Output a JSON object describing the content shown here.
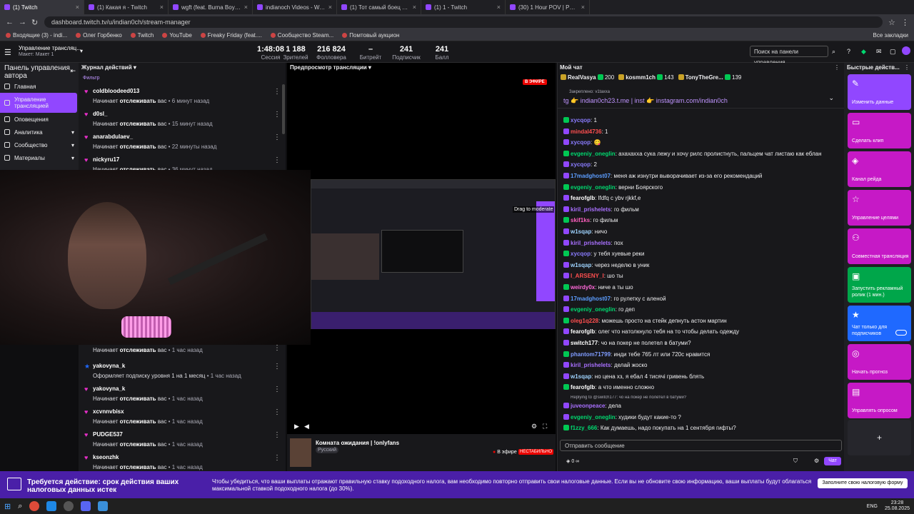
{
  "browser": {
    "tabs": [
      {
        "title": "(1) Twitch",
        "active": true
      },
      {
        "title": "(1) Какая я - Twitch"
      },
      {
        "title": "wgft (feat. Burna Boy) - You"
      },
      {
        "title": "indianoch Videos - Watch On-"
      },
      {
        "title": "(1) Тот самый боец - Twitch"
      },
      {
        "title": "(1) 1 - Twitch"
      },
      {
        "title": "(30) 1 Hour POV | Porsche 99"
      }
    ],
    "url": "dashboard.twitch.tv/u/indian0ch/stream-manager",
    "bookmarks": [
      "Входящие (3) - indi...",
      "Олег Горбенко",
      "Twitch",
      "YouTube",
      "Freaky Friday (feat....",
      "Сообщество Steam...",
      "Помтовый аукцион"
    ],
    "bookmarks_all": "Все закладки"
  },
  "top": {
    "title": "Управление трансляц...",
    "subtitle": "Макет: Макет 1",
    "stats": [
      {
        "value": "1:48:08",
        "label": "Сессия"
      },
      {
        "value": "1 188",
        "label": "Зрителей"
      },
      {
        "value": "216 824",
        "label": "Фолловера"
      },
      {
        "value": "–",
        "label": "Битрейт"
      },
      {
        "value": "241",
        "label": "Подписчик"
      },
      {
        "value": "241",
        "label": "Балл подписчиков"
      }
    ],
    "search_placeholder": "Поиск на панели управления"
  },
  "sidebar": {
    "title": "Панель управления автора",
    "items": [
      {
        "label": "Главная"
      },
      {
        "label": "Управление трансляцией",
        "active": true
      },
      {
        "label": "Оповещения"
      },
      {
        "label": "Аналитика",
        "arrow": "▾"
      },
      {
        "label": "Сообщество",
        "arrow": "▾"
      },
      {
        "label": "Материалы",
        "arrow": "▾"
      }
    ]
  },
  "feed": {
    "title": "Журнал действий",
    "filter": "Фильтр",
    "items": [
      {
        "name": "coldbloodeed013",
        "pre": "Начинает",
        "action": "отслеживать",
        "post": "вас",
        "time": "6 минут назад"
      },
      {
        "name": "d0sl_",
        "pre": "Начинает",
        "action": "отслеживать",
        "post": "вас",
        "time": "15 минут назад"
      },
      {
        "name": "anarabdulaev_",
        "pre": "Начинает",
        "action": "отслеживать",
        "post": "вас",
        "time": "22 минуты назад"
      },
      {
        "name": "nickyru17",
        "pre": "Начинает",
        "action": "отслеживать",
        "post": "вас",
        "time": "36 минут назад"
      },
      {
        "name": "gabar859",
        "pre": "Начинает",
        "action": "отслеживать",
        "post": "вас",
        "time": "1 час назад"
      },
      {
        "name": "yakovyna_k",
        "pre": "Оформляет подписку уровня 1 на 1 месяц",
        "action": "",
        "post": "",
        "time": "1 час назад",
        "star": true
      },
      {
        "name": "yakovyna_k",
        "pre": "Начинает",
        "action": "отслеживать",
        "post": "вас",
        "time": "1 час назад"
      },
      {
        "name": "xcvnnvbisx",
        "pre": "Начинает",
        "action": "отслеживать",
        "post": "вас",
        "time": "1 час назад"
      },
      {
        "name": "PUDGE537",
        "pre": "Начинает",
        "action": "отслеживать",
        "post": "вас",
        "time": "1 час назад"
      },
      {
        "name": "kseonzhk",
        "pre": "Начинает",
        "action": "отслеживать",
        "post": "вас",
        "time": "1 час назад"
      }
    ]
  },
  "preview": {
    "title": "Предпросмотр трансляции",
    "live_badge": "В ЭФИРЕ",
    "drag_hint": "Drag to moderate",
    "stream_title": "Комната ожидания | !onlyfans",
    "language": "Русский",
    "on_air": "В эфире",
    "unstable": "НЕСТАБИЛЬНО"
  },
  "chat": {
    "title": "Мой чат",
    "top_gifters": [
      {
        "name": "RealVasya",
        "count": "200"
      },
      {
        "name": "kosmm1ch",
        "count": "143"
      },
      {
        "name": "TonyTheGre...",
        "count": "139"
      }
    ],
    "pinned_label": "Закреплено: v1taxxa",
    "pinned_text": "tg 👉 indian0ch23.t.me | inst 👉 instagram.com/indian0ch",
    "messages": [
      {
        "user": "xycqop",
        "color": "#8a7cff",
        "text": "1"
      },
      {
        "user": "mindal4736",
        "color": "#ff4f4f",
        "text": "1"
      },
      {
        "user": "xycqop",
        "color": "#8a7cff",
        "text": "😋"
      },
      {
        "user": "evgeniy_oneglin",
        "color": "#00d96f",
        "text": "ахахахха сука лежу и хочу рилс пролистнуть, пальцем чат листаю как еблан"
      },
      {
        "user": "xycqop",
        "color": "#8a7cff",
        "text": "2"
      },
      {
        "user": "17madghost07",
        "color": "#5c9dff",
        "text": "меня аж изнутри выворачивает из-за его рекомендаций"
      },
      {
        "user": "evgeniy_oneglin",
        "color": "#00d96f",
        "text": "верни Боярского"
      },
      {
        "user": "fearofglb",
        "color": "#fff",
        "text": "lfdfq c ybv rjkkf,e"
      },
      {
        "user": "kiril_prishelets",
        "color": "#a970ff",
        "text": "го фильм"
      },
      {
        "user": "skif1ks",
        "color": "#ff5fbf",
        "text": "го фильм"
      },
      {
        "user": "w1sqap",
        "color": "#9fd4ff",
        "text": "ничо"
      },
      {
        "user": "kiril_prishelets",
        "color": "#a970ff",
        "text": "пох"
      },
      {
        "user": "xycqop",
        "color": "#8a7cff",
        "text": "у тебя хуевые реки"
      },
      {
        "user": "w1sqap",
        "color": "#9fd4ff",
        "text": "через неделю в уник"
      },
      {
        "user": "I_ARSENY_I",
        "color": "#ff4f4f",
        "text": "шо ты"
      },
      {
        "user": "weirdy0x",
        "color": "#ff69d9",
        "text": "ниче а ты шо"
      },
      {
        "user": "17madghost07",
        "color": "#5c9dff",
        "text": "го рулетку с аленой"
      },
      {
        "user": "evgeniy_oneglin",
        "color": "#00d96f",
        "text": "го деп"
      },
      {
        "user": "oleg1q228",
        "color": "#ff4f4f",
        "text": "можешь просто на стейк депнуть астон мартин"
      },
      {
        "user": "fearofglb",
        "color": "#fff",
        "text": "олег что натолкнуло тебя на то чтобы делать одежду"
      },
      {
        "user": "switch177",
        "color": "#fff",
        "text": "чо на покер не полетел в батуми?"
      },
      {
        "user": "phantom71799",
        "color": "#7f9cff",
        "text": "инди тебе 765 лт или 720с нравится"
      },
      {
        "user": "kiril_prishelets",
        "color": "#a970ff",
        "text": "делай жоско"
      },
      {
        "user": "w1sqap",
        "color": "#9fd4ff",
        "text": "но цена хз, я ебал 4 тисячі гривень блять"
      },
      {
        "user": "fearofglb",
        "color": "#fff",
        "text": "а что именно сложно"
      },
      {
        "user": "juveonpeace",
        "color": "#a970ff",
        "text": "дела",
        "reply": "Replying to @switch177: чо на покер не полетел в батуми?"
      },
      {
        "user": "evgeniy_oneglin",
        "color": "#00d96f",
        "text": "худики будут какие-то ?"
      },
      {
        "user": "f1zzy_666",
        "color": "#00d96f",
        "text": "Как думаешь, надо покупать на 1 сентября гифты?"
      }
    ],
    "input_placeholder": "Отправить сообщение",
    "points": "0",
    "send_label": "Чат"
  },
  "quick_actions": {
    "title": "Быстрые действ...",
    "buttons": [
      {
        "label": "Изменить данные",
        "icon": "✎",
        "color": "#9147ff"
      },
      {
        "label": "Сделать клип",
        "icon": "▭",
        "color": "#c619c6"
      },
      {
        "label": "Канал рейда",
        "icon": "◈",
        "color": "#c619c6"
      },
      {
        "label": "Управление целями",
        "icon": "☆",
        "color": "#c619c6"
      },
      {
        "label": "Совместная трансляция",
        "icon": "⚇",
        "color": "#c619c6"
      },
      {
        "label": "Запустить рекламный ролик (1 мин.)",
        "icon": "▣",
        "color": "#00a64a"
      },
      {
        "label": "Чат только для подписчиков",
        "icon": "★",
        "color": "#1f69ff"
      },
      {
        "label": "Начать прогноз",
        "icon": "◎",
        "color": "#c619c6"
      },
      {
        "label": "Управлять опросом",
        "icon": "▤",
        "color": "#c619c6"
      }
    ],
    "add": "+"
  },
  "banner": {
    "title": "Требуется действие: срок действия ваших налоговых данных истек",
    "text": "Чтобы убедиться, что ваши выплаты отражают правильную ставку подоходного налога, вам необходимо повторно отправить свои налоговые данные. Если вы не обновите свою информацию, ваши выплаты будут облагаться максимальной ставкой подоходного налога (до 30%).",
    "button": "Заполните свою налоговую форму"
  },
  "taskbar": {
    "lang": "ENG",
    "time": "23:28",
    "date": "25.08.2025"
  }
}
